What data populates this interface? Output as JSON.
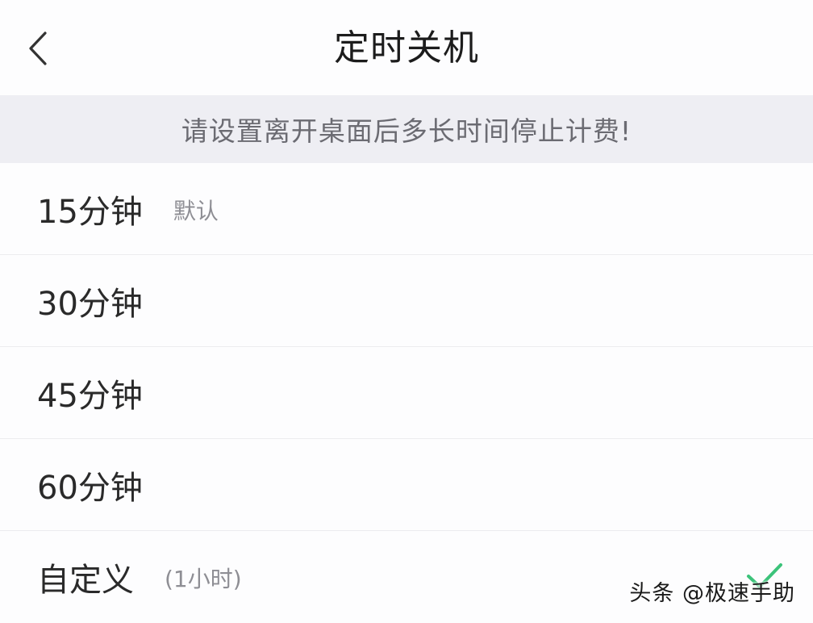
{
  "header": {
    "title": "定时关机",
    "back_icon": "chevron-left-icon"
  },
  "notice": {
    "text": "请设置离开桌面后多长时间停止计费!"
  },
  "options": [
    {
      "label": "15分钟",
      "note": "默认",
      "selected": false
    },
    {
      "label": "30分钟",
      "note": "",
      "selected": false
    },
    {
      "label": "45分钟",
      "note": "",
      "selected": false
    },
    {
      "label": "60分钟",
      "note": "",
      "selected": false
    },
    {
      "label": "自定义",
      "note": "(1小时)",
      "selected": true
    }
  ],
  "colors": {
    "accent_check": "#3cc37a",
    "notice_bg": "#eeeef3"
  },
  "watermark": {
    "text": "头条 @极速手助"
  }
}
